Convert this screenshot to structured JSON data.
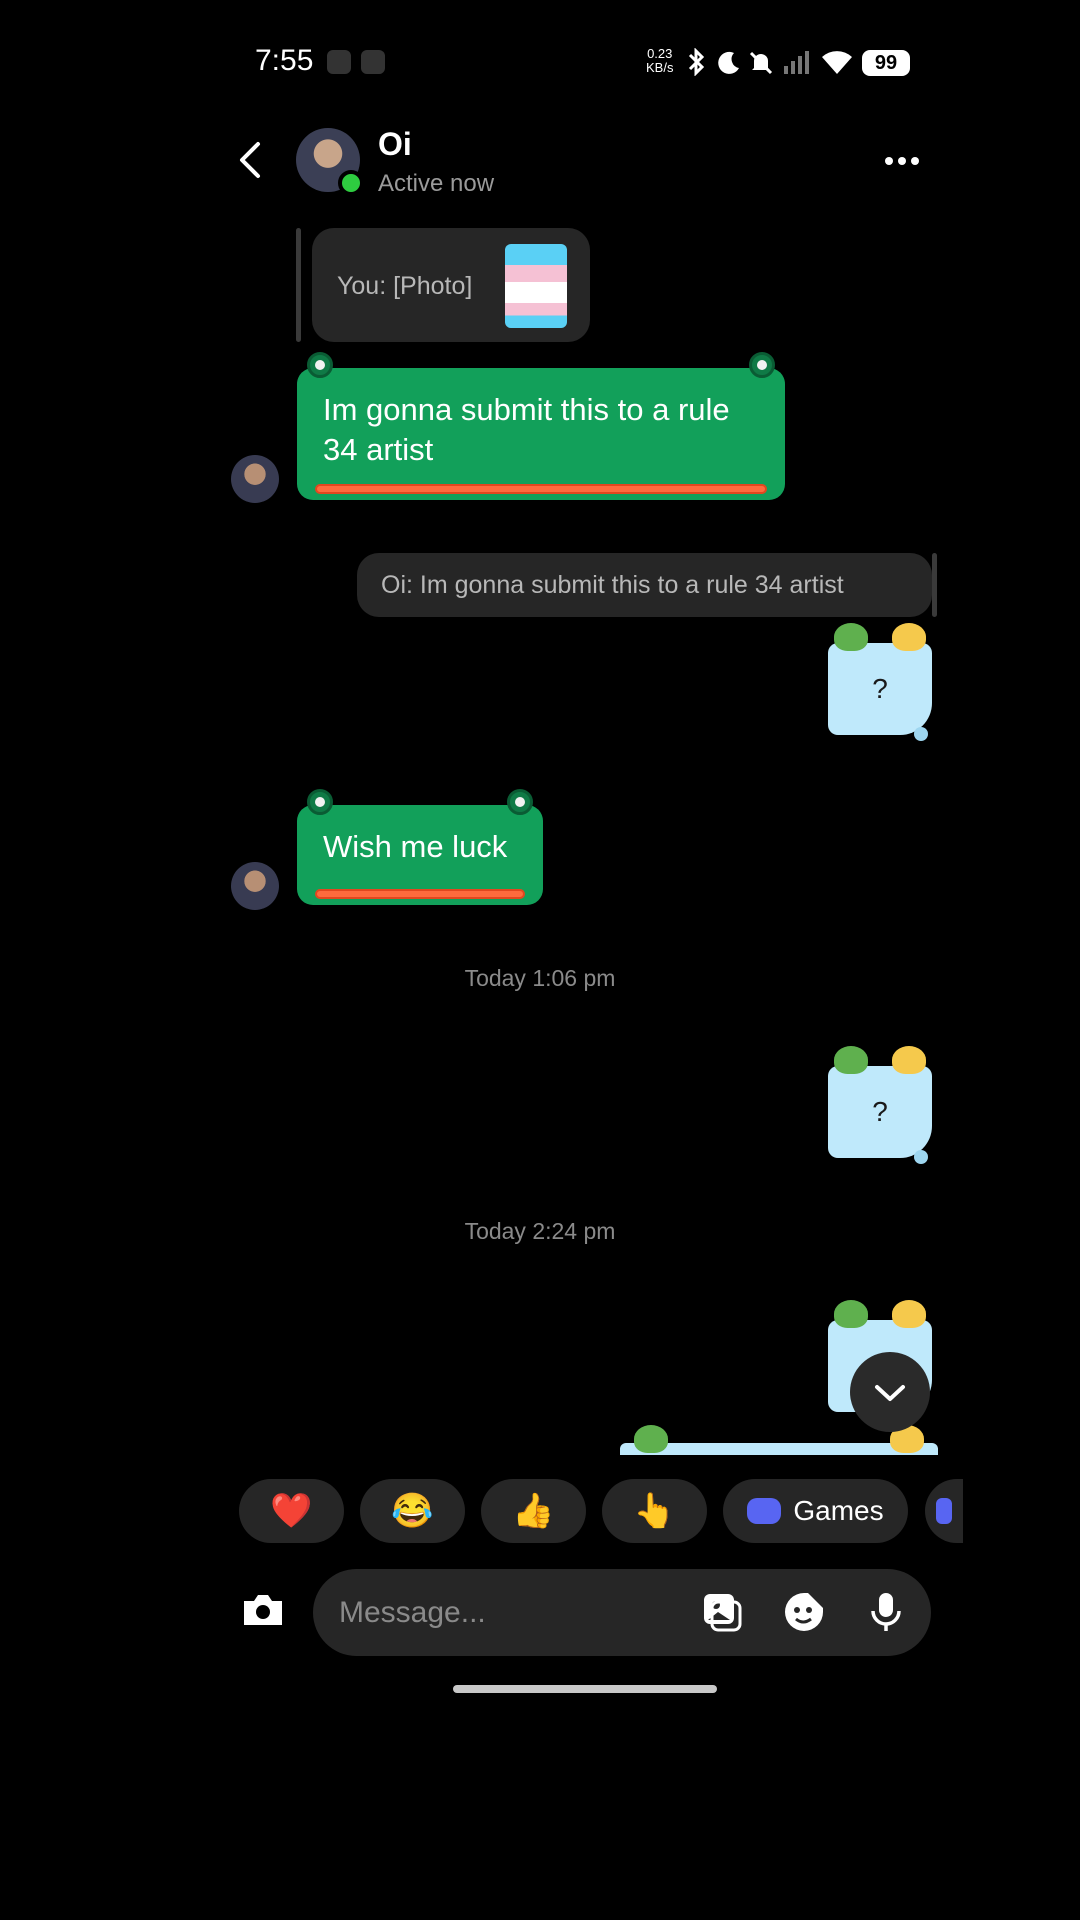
{
  "status_bar": {
    "time": "7:55",
    "net_speed_value": "0.23",
    "net_speed_unit": "KB/s",
    "battery": "99"
  },
  "header": {
    "contact_name": "Oi",
    "status": "Active now"
  },
  "messages": {
    "reply_preview": "You: [Photo]",
    "m1": "Im gonna submit this to a rule 34 artist",
    "out_reply_preview": "Oi: Im gonna submit this to a rule 34 artist",
    "q1": "?",
    "m2": "Wish me luck",
    "ts1": "Today 1:06 pm",
    "q2": "?",
    "ts2": "Today 2:24 pm"
  },
  "quick_reactions": {
    "r1": "❤️",
    "r2": "😂",
    "r3": "👍",
    "r4": "👆",
    "games_label": "Games"
  },
  "composer": {
    "placeholder": "Message..."
  },
  "colors": {
    "background": "#000000",
    "green_bubble": "#12a05a",
    "blue_bubble": "#bfe9fb",
    "online": "#2ecc40",
    "accent_games": "#5865f2"
  }
}
